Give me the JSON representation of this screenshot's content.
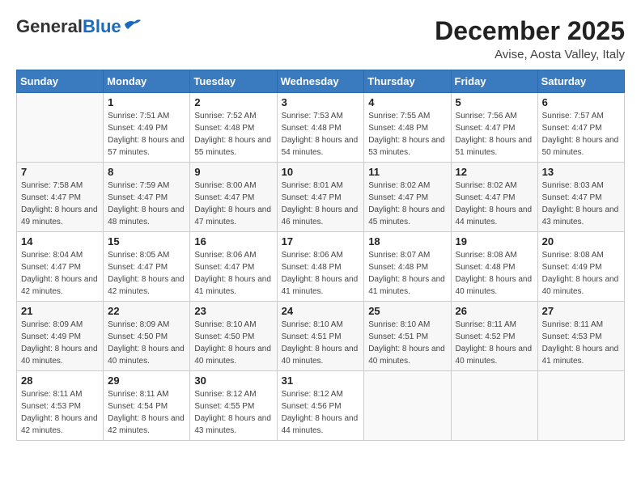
{
  "header": {
    "logo_general": "General",
    "logo_blue": "Blue",
    "month": "December 2025",
    "location": "Avise, Aosta Valley, Italy"
  },
  "weekdays": [
    "Sunday",
    "Monday",
    "Tuesday",
    "Wednesday",
    "Thursday",
    "Friday",
    "Saturday"
  ],
  "weeks": [
    [
      {
        "day": "",
        "sunrise": "",
        "sunset": "",
        "daylight": ""
      },
      {
        "day": "1",
        "sunrise": "Sunrise: 7:51 AM",
        "sunset": "Sunset: 4:49 PM",
        "daylight": "Daylight: 8 hours and 57 minutes."
      },
      {
        "day": "2",
        "sunrise": "Sunrise: 7:52 AM",
        "sunset": "Sunset: 4:48 PM",
        "daylight": "Daylight: 8 hours and 55 minutes."
      },
      {
        "day": "3",
        "sunrise": "Sunrise: 7:53 AM",
        "sunset": "Sunset: 4:48 PM",
        "daylight": "Daylight: 8 hours and 54 minutes."
      },
      {
        "day": "4",
        "sunrise": "Sunrise: 7:55 AM",
        "sunset": "Sunset: 4:48 PM",
        "daylight": "Daylight: 8 hours and 53 minutes."
      },
      {
        "day": "5",
        "sunrise": "Sunrise: 7:56 AM",
        "sunset": "Sunset: 4:47 PM",
        "daylight": "Daylight: 8 hours and 51 minutes."
      },
      {
        "day": "6",
        "sunrise": "Sunrise: 7:57 AM",
        "sunset": "Sunset: 4:47 PM",
        "daylight": "Daylight: 8 hours and 50 minutes."
      }
    ],
    [
      {
        "day": "7",
        "sunrise": "Sunrise: 7:58 AM",
        "sunset": "Sunset: 4:47 PM",
        "daylight": "Daylight: 8 hours and 49 minutes."
      },
      {
        "day": "8",
        "sunrise": "Sunrise: 7:59 AM",
        "sunset": "Sunset: 4:47 PM",
        "daylight": "Daylight: 8 hours and 48 minutes."
      },
      {
        "day": "9",
        "sunrise": "Sunrise: 8:00 AM",
        "sunset": "Sunset: 4:47 PM",
        "daylight": "Daylight: 8 hours and 47 minutes."
      },
      {
        "day": "10",
        "sunrise": "Sunrise: 8:01 AM",
        "sunset": "Sunset: 4:47 PM",
        "daylight": "Daylight: 8 hours and 46 minutes."
      },
      {
        "day": "11",
        "sunrise": "Sunrise: 8:02 AM",
        "sunset": "Sunset: 4:47 PM",
        "daylight": "Daylight: 8 hours and 45 minutes."
      },
      {
        "day": "12",
        "sunrise": "Sunrise: 8:02 AM",
        "sunset": "Sunset: 4:47 PM",
        "daylight": "Daylight: 8 hours and 44 minutes."
      },
      {
        "day": "13",
        "sunrise": "Sunrise: 8:03 AM",
        "sunset": "Sunset: 4:47 PM",
        "daylight": "Daylight: 8 hours and 43 minutes."
      }
    ],
    [
      {
        "day": "14",
        "sunrise": "Sunrise: 8:04 AM",
        "sunset": "Sunset: 4:47 PM",
        "daylight": "Daylight: 8 hours and 42 minutes."
      },
      {
        "day": "15",
        "sunrise": "Sunrise: 8:05 AM",
        "sunset": "Sunset: 4:47 PM",
        "daylight": "Daylight: 8 hours and 42 minutes."
      },
      {
        "day": "16",
        "sunrise": "Sunrise: 8:06 AM",
        "sunset": "Sunset: 4:47 PM",
        "daylight": "Daylight: 8 hours and 41 minutes."
      },
      {
        "day": "17",
        "sunrise": "Sunrise: 8:06 AM",
        "sunset": "Sunset: 4:48 PM",
        "daylight": "Daylight: 8 hours and 41 minutes."
      },
      {
        "day": "18",
        "sunrise": "Sunrise: 8:07 AM",
        "sunset": "Sunset: 4:48 PM",
        "daylight": "Daylight: 8 hours and 41 minutes."
      },
      {
        "day": "19",
        "sunrise": "Sunrise: 8:08 AM",
        "sunset": "Sunset: 4:48 PM",
        "daylight": "Daylight: 8 hours and 40 minutes."
      },
      {
        "day": "20",
        "sunrise": "Sunrise: 8:08 AM",
        "sunset": "Sunset: 4:49 PM",
        "daylight": "Daylight: 8 hours and 40 minutes."
      }
    ],
    [
      {
        "day": "21",
        "sunrise": "Sunrise: 8:09 AM",
        "sunset": "Sunset: 4:49 PM",
        "daylight": "Daylight: 8 hours and 40 minutes."
      },
      {
        "day": "22",
        "sunrise": "Sunrise: 8:09 AM",
        "sunset": "Sunset: 4:50 PM",
        "daylight": "Daylight: 8 hours and 40 minutes."
      },
      {
        "day": "23",
        "sunrise": "Sunrise: 8:10 AM",
        "sunset": "Sunset: 4:50 PM",
        "daylight": "Daylight: 8 hours and 40 minutes."
      },
      {
        "day": "24",
        "sunrise": "Sunrise: 8:10 AM",
        "sunset": "Sunset: 4:51 PM",
        "daylight": "Daylight: 8 hours and 40 minutes."
      },
      {
        "day": "25",
        "sunrise": "Sunrise: 8:10 AM",
        "sunset": "Sunset: 4:51 PM",
        "daylight": "Daylight: 8 hours and 40 minutes."
      },
      {
        "day": "26",
        "sunrise": "Sunrise: 8:11 AM",
        "sunset": "Sunset: 4:52 PM",
        "daylight": "Daylight: 8 hours and 40 minutes."
      },
      {
        "day": "27",
        "sunrise": "Sunrise: 8:11 AM",
        "sunset": "Sunset: 4:53 PM",
        "daylight": "Daylight: 8 hours and 41 minutes."
      }
    ],
    [
      {
        "day": "28",
        "sunrise": "Sunrise: 8:11 AM",
        "sunset": "Sunset: 4:53 PM",
        "daylight": "Daylight: 8 hours and 42 minutes."
      },
      {
        "day": "29",
        "sunrise": "Sunrise: 8:11 AM",
        "sunset": "Sunset: 4:54 PM",
        "daylight": "Daylight: 8 hours and 42 minutes."
      },
      {
        "day": "30",
        "sunrise": "Sunrise: 8:12 AM",
        "sunset": "Sunset: 4:55 PM",
        "daylight": "Daylight: 8 hours and 43 minutes."
      },
      {
        "day": "31",
        "sunrise": "Sunrise: 8:12 AM",
        "sunset": "Sunset: 4:56 PM",
        "daylight": "Daylight: 8 hours and 44 minutes."
      },
      {
        "day": "",
        "sunrise": "",
        "sunset": "",
        "daylight": ""
      },
      {
        "day": "",
        "sunrise": "",
        "sunset": "",
        "daylight": ""
      },
      {
        "day": "",
        "sunrise": "",
        "sunset": "",
        "daylight": ""
      }
    ]
  ]
}
